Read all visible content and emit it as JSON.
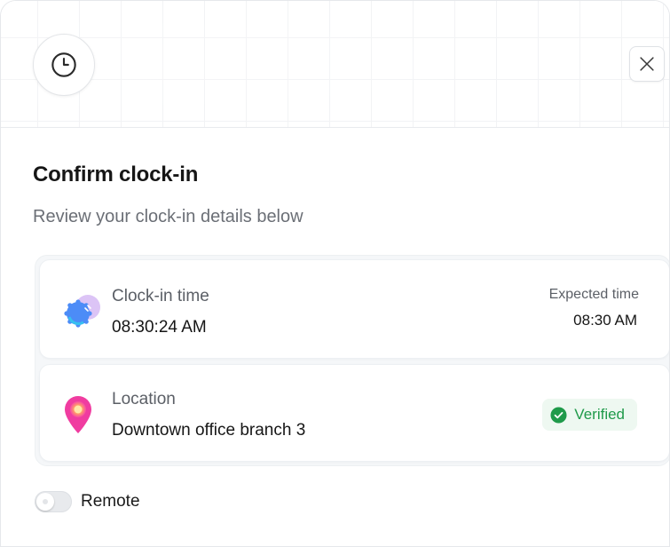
{
  "dialog": {
    "title": "Confirm clock-in",
    "subtitle": "Review your clock-in details below",
    "header_icon": "clock-icon",
    "close_icon": "close-icon"
  },
  "clock_in": {
    "icon": "clock-in-badge-icon",
    "label": "Clock-in time",
    "value": "08:30:24 AM",
    "expected_label": "Expected time",
    "expected_value": "08:30 AM"
  },
  "location": {
    "icon": "location-pin-icon",
    "label": "Location",
    "value": "Downtown office branch 3",
    "status_icon": "check-circle-icon",
    "status": "Verified"
  },
  "remote": {
    "label": "Remote",
    "enabled": false
  },
  "colors": {
    "verified_green": "#1f9a4a",
    "verified_bg": "#eef8f1",
    "pin_pink": "#f03ca0",
    "badge_purple": "#d6bbf5",
    "badge_blue": "#3b7cf6"
  }
}
